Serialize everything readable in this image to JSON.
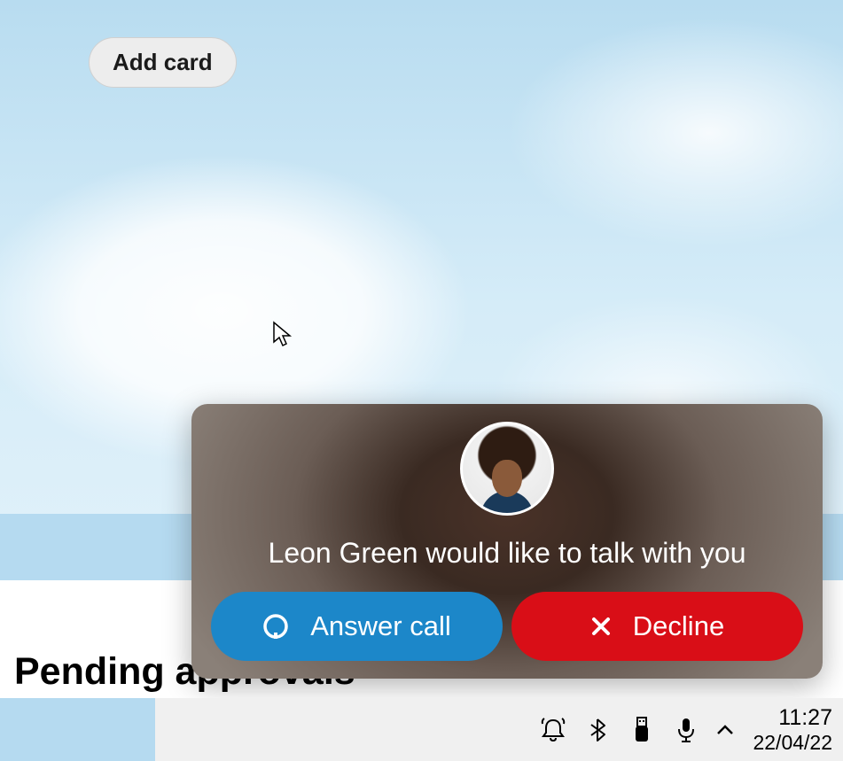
{
  "desktop": {
    "add_card_label": "Add card",
    "pending_heading": "Pending approvals"
  },
  "call": {
    "caller_name": "Leon Green",
    "message": "Leon Green would like to talk with you",
    "answer_label": "Answer call",
    "decline_label": "Decline"
  },
  "taskbar": {
    "time": "11:27",
    "date": "22/04/22",
    "icons": {
      "notifications": "notifications-icon",
      "bluetooth": "bluetooth-icon",
      "usb": "usb-device-icon",
      "microphone": "microphone-icon",
      "show_hidden": "chevron-up-icon"
    }
  }
}
